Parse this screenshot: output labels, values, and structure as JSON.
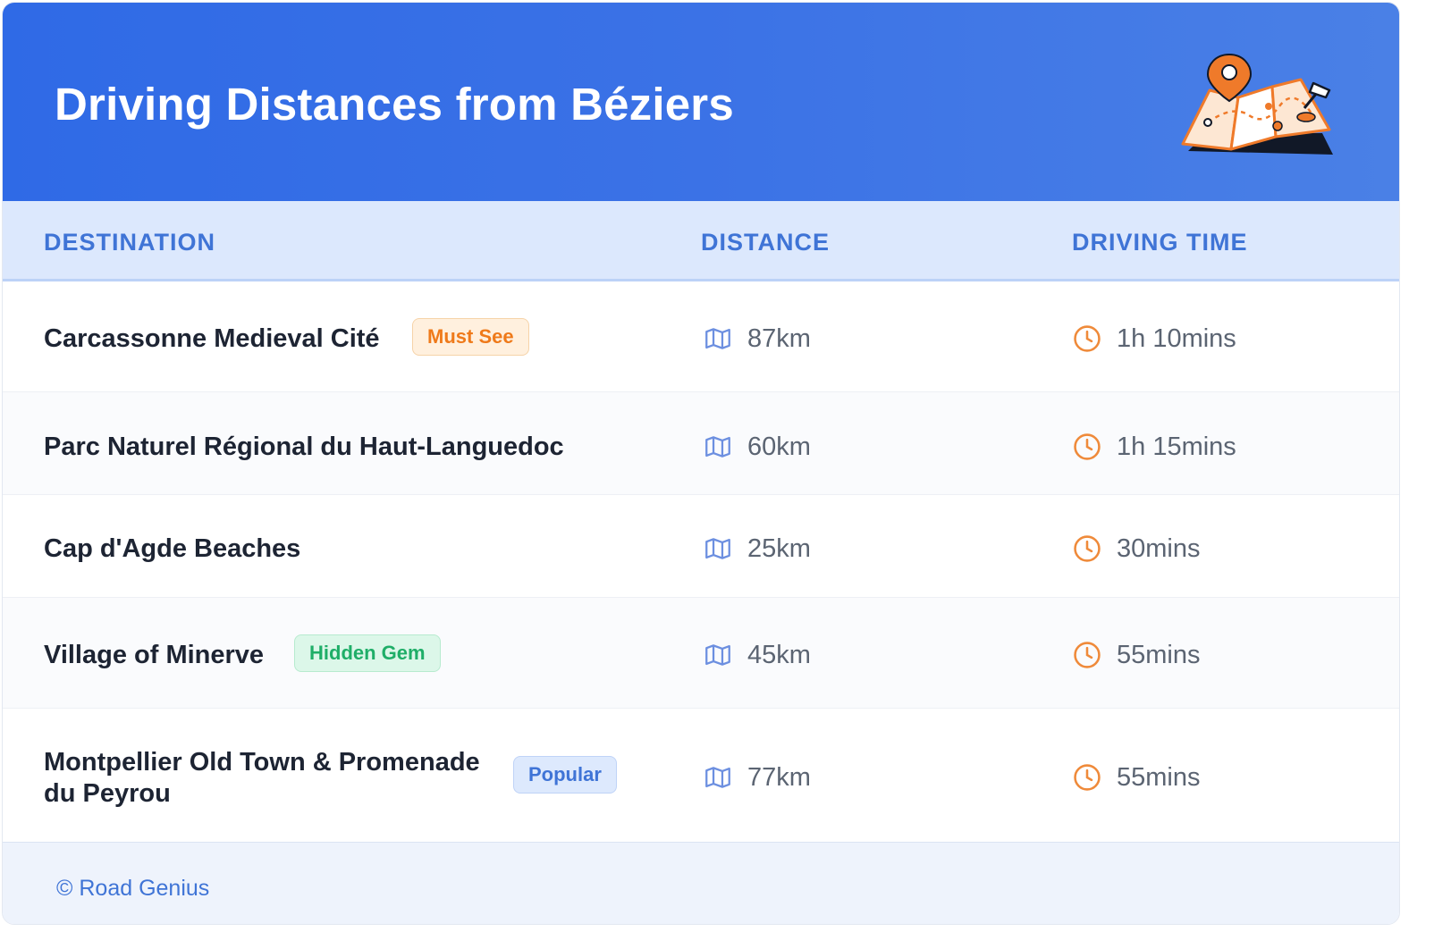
{
  "header": {
    "title": "Driving Distances from Béziers"
  },
  "table": {
    "columns": [
      "DESTINATION",
      "DISTANCE",
      "DRIVING TIME"
    ],
    "rows": [
      {
        "destination": "Carcassonne Medieval Cité",
        "badge": "Must See",
        "badge_color": "#ef7a1a",
        "distance": "87km",
        "time": "1h 10mins"
      },
      {
        "destination": "Parc Naturel Régional du Haut-Languedoc",
        "badge": "",
        "distance": "60km",
        "time": "1h 15mins"
      },
      {
        "destination": "Cap d'Agde Beaches",
        "badge": "",
        "distance": "25km",
        "time": "30mins"
      },
      {
        "destination": "Village of Minerve",
        "badge": "Hidden Gem",
        "badge_color": "#1fae68",
        "distance": "45km",
        "time": "55mins"
      },
      {
        "destination": "Montpellier Old Town & Promenade du Peyrou",
        "destination_line1": "Montpellier Old Town & Promenade",
        "destination_line2": "du Peyrou",
        "badge": "Popular",
        "badge_color": "#3f74d6",
        "distance": "77km",
        "time": "55mins"
      }
    ]
  },
  "icons": {
    "distance": "map-icon",
    "time": "clock-icon",
    "header": "map-with-pin-illustration"
  },
  "colors": {
    "header_blue": "#2f6ae6",
    "accent_orange": "#ef8a3a",
    "heading_blue": "#3f74d6"
  },
  "footer": {
    "text": "© Road Genius"
  }
}
